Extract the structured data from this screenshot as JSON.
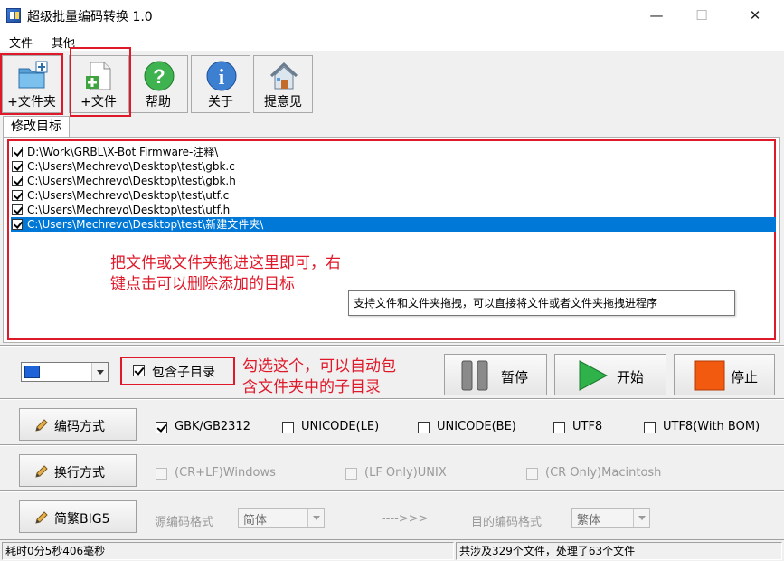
{
  "window": {
    "title": "超级批量编码转换 1.0",
    "controls": {
      "minimize": "—",
      "maximize": "☐",
      "close": "✕"
    }
  },
  "menu": [
    "文件",
    "其他"
  ],
  "toolbar": {
    "add_folder": "+文件夹",
    "add_file": "+文件",
    "help": "帮助",
    "about": "关于",
    "feedback": "提意见"
  },
  "tab": "修改目标",
  "files": [
    {
      "path": "D:\\Work\\GRBL\\X-Bot Firmware-注释\\",
      "checked": true,
      "selected": false
    },
    {
      "path": "C:\\Users\\Mechrevo\\Desktop\\test\\gbk.c",
      "checked": true,
      "selected": false
    },
    {
      "path": "C:\\Users\\Mechrevo\\Desktop\\test\\gbk.h",
      "checked": true,
      "selected": false
    },
    {
      "path": "C:\\Users\\Mechrevo\\Desktop\\test\\utf.c",
      "checked": true,
      "selected": false
    },
    {
      "path": "C:\\Users\\Mechrevo\\Desktop\\test\\utf.h",
      "checked": true,
      "selected": false
    },
    {
      "path": "C:\\Users\\Mechrevo\\Desktop\\test\\新建文件夹\\",
      "checked": true,
      "selected": true
    }
  ],
  "annotations": {
    "drag_hint_line1": "把文件或文件夹拖进这里即可，右",
    "drag_hint_line2": "键点击可以删除添加的目标",
    "subdir_hint_line1": "勾选这个，可以自动包",
    "subdir_hint_line2": "含文件夹中的子目录"
  },
  "tooltip": "支持文件和文件夹拖拽，可以直接将文件或者文件夹拖拽进程序",
  "controls": {
    "include_subdirs": "包含子目录",
    "include_subdirs_checked": true,
    "pause": "暂停",
    "start": "开始",
    "stop": "停止"
  },
  "encoding": {
    "button": "编码方式",
    "options": [
      {
        "label": "GBK/GB2312",
        "checked": true
      },
      {
        "label": "UNICODE(LE)",
        "checked": false
      },
      {
        "label": "UNICODE(BE)",
        "checked": false
      },
      {
        "label": "UTF8",
        "checked": false
      },
      {
        "label": "UTF8(With BOM)",
        "checked": false
      }
    ]
  },
  "line_ending": {
    "button": "换行方式",
    "options": [
      {
        "label": "(CR+LF)Windows",
        "checked": false
      },
      {
        "label": "(LF Only)UNIX",
        "checked": false
      },
      {
        "label": "(CR Only)Macintosh",
        "checked": false
      }
    ]
  },
  "big5": {
    "button": "简繁BIG5",
    "source_label": "源编码格式",
    "source_value": "简体",
    "arrow": "---->>>",
    "target_label": "目的编码格式",
    "target_value": "繁体"
  },
  "status": {
    "elapsed": "耗时0分5秒406毫秒",
    "summary": "共涉及329个文件，处理了63个文件"
  },
  "colors": {
    "annotation_red": "#e0192a",
    "selection_blue": "#0078d7",
    "start_green": "#2fb24a",
    "stop_orange": "#f25a0f"
  }
}
